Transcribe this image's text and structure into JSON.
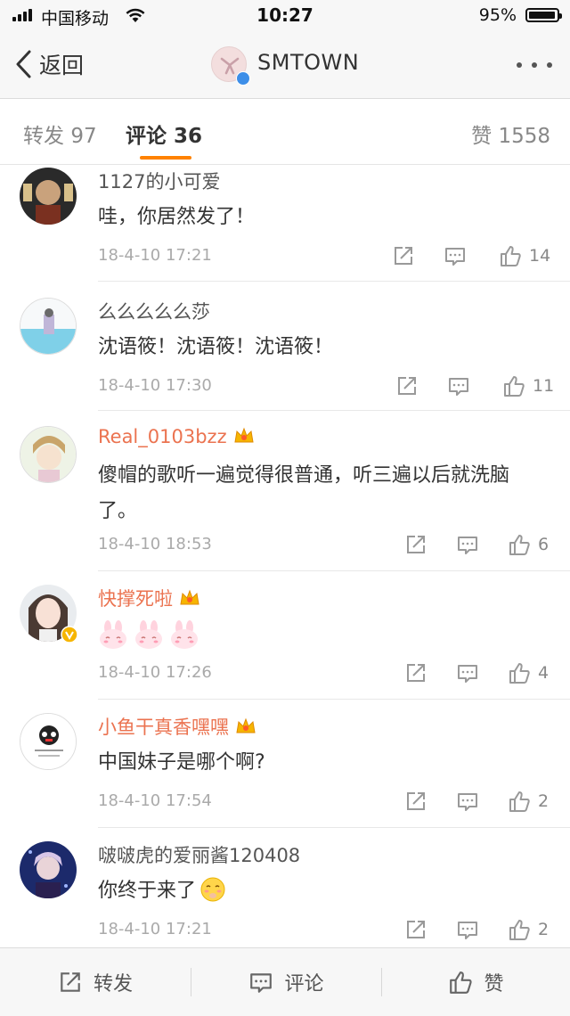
{
  "status_bar": {
    "carrier": "中国移动",
    "time": "10:27",
    "battery_percent": "95%",
    "battery_level": 0.95
  },
  "nav": {
    "back_label": "返回",
    "title": "SMTOWN"
  },
  "tabs": [
    {
      "label": "转发",
      "count": "97"
    },
    {
      "label": "评论",
      "count": "36"
    },
    {
      "label": "赞",
      "count": "1558"
    }
  ],
  "comments": [
    {
      "name": "1127的小可爱",
      "text": "哇，你居然发了！",
      "time": "18-4-10 17:21",
      "likes": "14",
      "vip": false
    },
    {
      "name": "么么么么么莎",
      "text": "沈语筱！沈语筱！沈语筱！",
      "time": "18-4-10 17:30",
      "likes": "11",
      "vip": false
    },
    {
      "name": "Real_0103bzz",
      "text": "傻帽的歌听一遍觉得很普通，听三遍以后就洗脑了。",
      "time": "18-4-10 18:53",
      "likes": "6",
      "vip": true
    },
    {
      "name": "快撑死啦",
      "text": "",
      "time": "18-4-10 17:26",
      "likes": "4",
      "vip": true,
      "emoji": [
        "rabbit-emoji",
        "rabbit-emoji",
        "rabbit-emoji"
      ]
    },
    {
      "name": "小鱼干真香嘿嘿",
      "text": "中国妹子是哪个啊?",
      "time": "18-4-10 17:54",
      "likes": "2",
      "vip": true
    },
    {
      "name": "啵啵虎的爱丽酱120408",
      "text": "你终于来了",
      "time": "18-4-10 17:21",
      "likes": "2",
      "vip": false,
      "emoji": [
        "shy-face-emoji"
      ]
    }
  ],
  "bottom_bar": {
    "repost_label": "转发",
    "comment_label": "评论",
    "like_label": "赞"
  },
  "colors": {
    "accent": "#ff8200",
    "vip_name": "#eb7350",
    "verified_blue": "#3d8ee8",
    "verified_gold": "#f6b500"
  }
}
